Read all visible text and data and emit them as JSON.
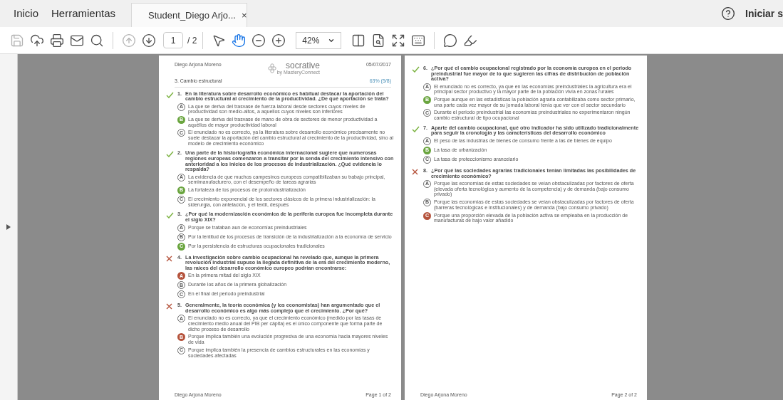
{
  "menu": {
    "items": [
      "Inicio",
      "Herramientas"
    ],
    "tab": {
      "title": "Student_Diego Arjo...",
      "close": "×"
    },
    "signin": "Iniciar s"
  },
  "toolbar": {
    "save_disabled": true,
    "prev_disabled": true,
    "page": "1",
    "page_count": "/ 2",
    "hand_selected": true,
    "zoom": "42%"
  },
  "pages": [
    {
      "header": {
        "author": "Diego Arjona Moreno",
        "logo": "socrative",
        "logo_sub": "by MasteryConnect",
        "date": "05/07/2017",
        "section": "3. Cambio estructural",
        "score": "63% (5/8)"
      },
      "questions": [
        {
          "number": "1.",
          "correct": true,
          "text": "En la literatura sobre desarrollo económico es habitual destacar la aportación del cambio estructural al crecimiento de la productividad. ¿De qué aportación se trata?",
          "options": [
            {
              "letter": "A",
              "selected": false,
              "text": "La que se deriva del trasvase de fuerza laboral desde sectores cuyos niveles de productividad son medio-altos, a aquellos cuyos niveles son inferiores"
            },
            {
              "letter": "B",
              "selected": true,
              "text": "La que se deriva del trasvase de mano de obra de sectores de menor productividad a aquéllos de mayor productividad laboral"
            },
            {
              "letter": "C",
              "selected": false,
              "text": "El enunciado no es correcto, ya la literatura sobre desarrollo económico precisamente no suele destacar la aportación del cambio estructural al crecimiento de la productividad, sino al modelo de crecimiento económico"
            }
          ]
        },
        {
          "number": "2.",
          "correct": true,
          "text": "Una parte de la historiografía económica internacional sugiere que numerosas regiones europeas comenzaron a transitar por la senda del crecimiento intensivo con anterioridad a los inicios de los procesos de industrialización. ¿Qué evidencia lo respalda?",
          "options": [
            {
              "letter": "A",
              "selected": false,
              "text": "La evidencia de que muchos campesinos europeos compatibilizaban su trabajo principal, semimanufacturero, con el desempeño de tareas agrarias"
            },
            {
              "letter": "B",
              "selected": true,
              "text": "La fortaleza de los procesos de protoindustrialización"
            },
            {
              "letter": "C",
              "selected": false,
              "text": "El crecimiento exponencial de los sectores clásicos de la primera industrialización: la siderurgia, con antelación, y el textil, después"
            }
          ]
        },
        {
          "number": "3.",
          "correct": true,
          "text": "¿Por qué la modernización económica de la periferia europea fue incompleta durante el siglo XIX?",
          "options": [
            {
              "letter": "A",
              "selected": false,
              "text": "Porque se trataban aun de economías preindustriales"
            },
            {
              "letter": "B",
              "selected": false,
              "text": "Por la lentitud de los procesos de transición de la industrialización a la economía de servicio"
            },
            {
              "letter": "C",
              "selected": true,
              "text": "Por la persistencia de estructuras ocupacionales tradicionales"
            }
          ]
        },
        {
          "number": "4.",
          "correct": false,
          "text": "La investigación sobre cambio ocupacional ha revelado que, aunque la primera revolución industrial supuso la llegada definitiva de la era del crecimiento moderno, las raíces del desarrollo económico europeo podrían encontrarse:",
          "options": [
            {
              "letter": "A",
              "selected": true,
              "text": "En la primera mitad del siglo XIX"
            },
            {
              "letter": "B",
              "selected": false,
              "text": "Durante los años de la primera globalización"
            },
            {
              "letter": "C",
              "selected": false,
              "text": "En el final del periodo preindustrial"
            }
          ]
        },
        {
          "number": "5.",
          "correct": false,
          "text": "Generalmente, la teoría económica (y los economistas) han argumentado que el desarrollo económico es algo más complejo que el crecimiento. ¿Por qué?",
          "options": [
            {
              "letter": "A",
              "selected": false,
              "text": "El enunciado no es correcto, ya que el crecimiento económico (medido por las tasas de crecimiento medio anual del PIB per cápita) es el único componente que forma parte de dicho proceso de desarrollo"
            },
            {
              "letter": "B",
              "selected": true,
              "text": "Porque implica también una evolución progresiva de una economía hacia mayores niveles de vida"
            },
            {
              "letter": "C",
              "selected": false,
              "text": "Porque implica también la presencia de cambios estructurales en las economías y sociedades afectadas"
            }
          ]
        }
      ],
      "footer": {
        "author": "Diego Arjona Moreno",
        "page": "Page 1 of 2"
      }
    },
    {
      "questions": [
        {
          "number": "6.",
          "correct": true,
          "text": "¿Por qué el cambio ocupacional registrado por la economía europea en el periodo preindustrial fue mayor de lo que sugieren las cifras de distribución de población activa?",
          "options": [
            {
              "letter": "A",
              "selected": false,
              "text": "El enunciado no es correcto, ya que en las economías preindustriales la agricultura era el principal sector productivo y la mayor parte de la población vivía en zonas rurales"
            },
            {
              "letter": "B",
              "selected": true,
              "text": "Porque aunque en las estadísticas la población agraria contabilizaba como sector primario, una parte cada vez mayor de su jornada laboral tenía que ver con el sector secundario"
            },
            {
              "letter": "C",
              "selected": false,
              "text": "Durante el periodo preindustrial las economías preindustriales no experimentaron ningún cambio estructural de tipo ocupacional"
            }
          ]
        },
        {
          "number": "7.",
          "correct": true,
          "text": "Aparte del cambio ocupacional, qué otro indicador ha sido utilizado tradicionalmente para seguir la cronología y las características del desarrollo económico",
          "options": [
            {
              "letter": "A",
              "selected": false,
              "text": "El peso de las industrias de bienes de consumo frente a las de bienes de equipo"
            },
            {
              "letter": "B",
              "selected": true,
              "text": "La tasa de urbanización"
            },
            {
              "letter": "C",
              "selected": false,
              "text": "La tasa de proteccionismo arancelario"
            }
          ]
        },
        {
          "number": "8.",
          "correct": false,
          "text": "¿Por qué las sociedades agrarias tradicionales tenían limitadas las posibilidades de crecimiento económico?",
          "options": [
            {
              "letter": "A",
              "selected": false,
              "text": "Porque las economías de estas sociedades se veían obstaculizadas por factores de oferta (elevada oferta tecnológica y aumento de la competencia) y de demanda (bajo consumo privado)"
            },
            {
              "letter": "B",
              "selected": false,
              "text": "Porque las economías de estas sociedades se veían obstaculizadas por factores de oferta (barreras tecnológicas e institucionales) y de demanda (bajo consumo privado)"
            },
            {
              "letter": "C",
              "selected": true,
              "text": "Porque una proporción elevada de la población activa se empleaba en la producción de manufacturas de bajo valor añadido"
            }
          ]
        }
      ],
      "footer": {
        "author": "Diego Arjona Moreno",
        "page": "Page 2 of 2"
      }
    }
  ]
}
